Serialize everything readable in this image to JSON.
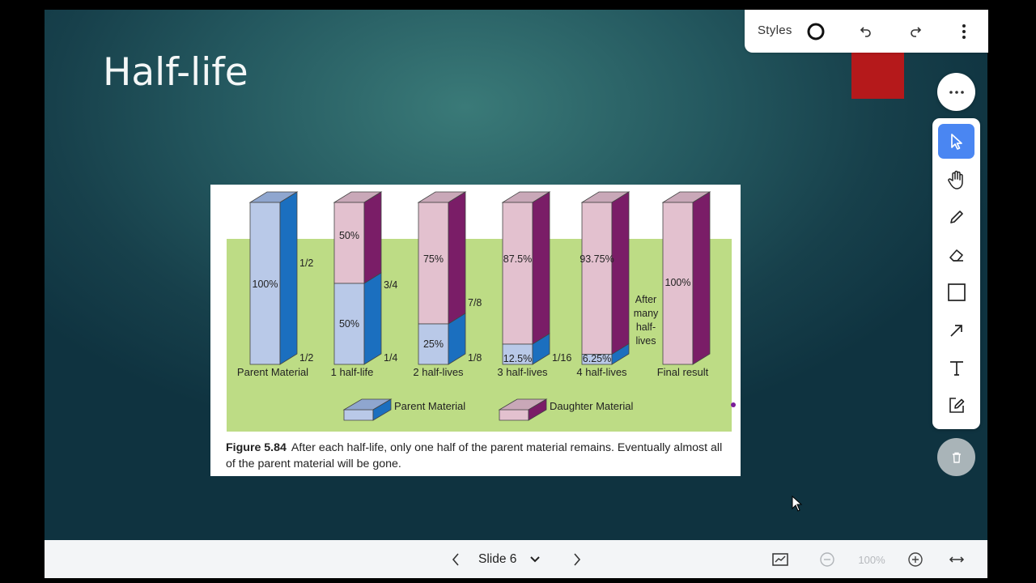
{
  "slide": {
    "title": "Half-life",
    "figure": {
      "columns": [
        {
          "label": "Parent Material",
          "parent_pct": 100,
          "parent_label": "100%",
          "daughter_label": "",
          "frac_top": "1/2",
          "frac_bottom": "1/2"
        },
        {
          "label": "1 half-life",
          "parent_pct": 50,
          "parent_label": "50%",
          "daughter_label": "50%",
          "frac_top": "3/4",
          "frac_bottom": "1/4"
        },
        {
          "label": "2 half-lives",
          "parent_pct": 25,
          "parent_label": "25%",
          "daughter_label": "75%",
          "frac_top": "7/8",
          "frac_bottom": "1/8"
        },
        {
          "label": "3 half-lives",
          "parent_pct": 12.5,
          "parent_label": "12.5%",
          "daughter_label": "87.5%",
          "frac_top": "",
          "frac_bottom": "1/16"
        },
        {
          "label": "4 half-lives",
          "parent_pct": 6.25,
          "parent_label": "6.25%",
          "daughter_label": "93.75%",
          "frac_top": "",
          "frac_bottom": ""
        },
        {
          "label": "Final result",
          "parent_pct": 0,
          "parent_label": "",
          "daughter_label": "100%",
          "frac_top": "",
          "frac_bottom": ""
        }
      ],
      "after_many_lines": [
        "After",
        "many",
        "half-",
        "lives"
      ],
      "legend": {
        "parent": "Parent Material",
        "daughter": "Daughter Material"
      },
      "caption_label": "Figure 5.84",
      "caption_text": "After each half-life, only one half of the parent material remains. Eventually almost all of the parent material will be gone.",
      "colors": {
        "parent_front": "#b9c9e8",
        "parent_side": "#1b6fbf",
        "daughter_front": "#e3c1cf",
        "daughter_side": "#7a1d67",
        "band": "#bddc85"
      }
    },
    "accent_shape_color": "#b5191b"
  },
  "toolbar": {
    "styles_label": "Styles"
  },
  "bottom_bar": {
    "slide_label": "Slide 6",
    "zoom_level": "100%"
  }
}
